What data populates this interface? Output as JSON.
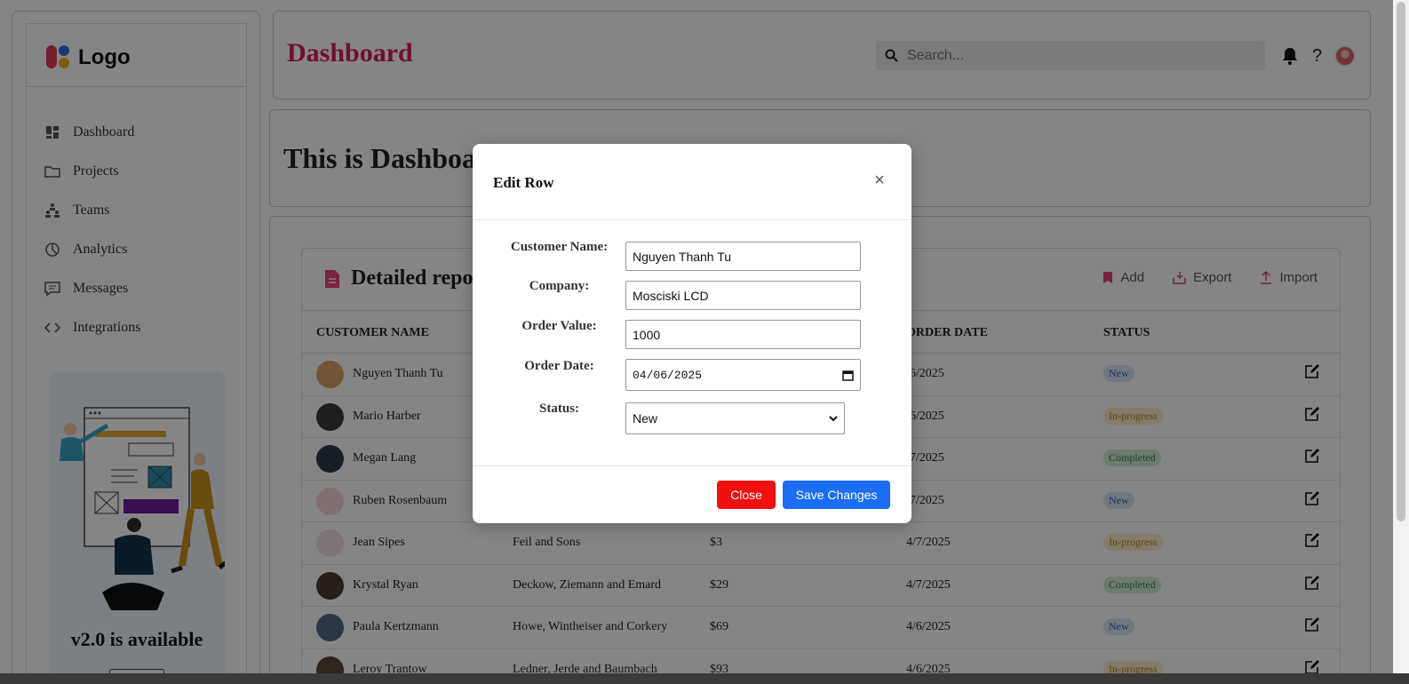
{
  "brand": {
    "logo_text": "Logo"
  },
  "sidebar": {
    "items": [
      {
        "label": "Dashboard",
        "icon": "dashboard-icon"
      },
      {
        "label": "Projects",
        "icon": "folder-icon"
      },
      {
        "label": "Teams",
        "icon": "teams-icon"
      },
      {
        "label": "Analytics",
        "icon": "pie-chart-icon"
      },
      {
        "label": "Messages",
        "icon": "message-icon"
      },
      {
        "label": "Integrations",
        "icon": "code-icon"
      }
    ],
    "promo_title": "v2.0 is available"
  },
  "header": {
    "title": "Dashboard",
    "search_placeholder": "Search...",
    "help_label": "?"
  },
  "banner": {
    "text": "This is Dashboa"
  },
  "report": {
    "title": "Detailed repo",
    "actions": {
      "add": "Add",
      "export": "Export",
      "import": "Import"
    },
    "columns": {
      "customer": "CUSTOMER NAME",
      "order_date": "ORDER DATE",
      "status": "STATUS"
    },
    "rows": [
      {
        "name": "Nguyen Thanh Tu",
        "company": "",
        "value": "",
        "date": "/6/2025",
        "status": "New",
        "kind": "new",
        "avatar": "#d9a36a"
      },
      {
        "name": "Mario Harber",
        "company": "",
        "value": "",
        "date": "/6/2025",
        "status": "In-progress",
        "kind": "progress",
        "avatar": "#3b3b3b"
      },
      {
        "name": "Megan Lang",
        "company": "",
        "value": "",
        "date": "/7/2025",
        "status": "Completed",
        "kind": "done",
        "avatar": "#2f3a4a"
      },
      {
        "name": "Ruben Rosenbaum",
        "company": "",
        "value": "",
        "date": "/7/2025",
        "status": "New",
        "kind": "new",
        "avatar": "#f5d6da"
      },
      {
        "name": "Jean Sipes",
        "company": "Feil and Sons",
        "value": "$3",
        "date": "4/7/2025",
        "status": "In-progress",
        "kind": "progress",
        "avatar": "#f3dfe3"
      },
      {
        "name": "Krystal Ryan",
        "company": "Deckow, Ziemann and Emard",
        "value": "$29",
        "date": "4/7/2025",
        "status": "Completed",
        "kind": "done",
        "avatar": "#4a3b30"
      },
      {
        "name": "Paula Kertzmann",
        "company": "Howe, Wintheiser and Corkery",
        "value": "$69",
        "date": "4/6/2025",
        "status": "New",
        "kind": "new",
        "avatar": "#546a80"
      },
      {
        "name": "Leroy Trantow",
        "company": "Ledner, Jerde and Baumbach",
        "value": "$93",
        "date": "4/6/2025",
        "status": "In-progress",
        "kind": "progress",
        "avatar": "#5a4a3a"
      }
    ]
  },
  "modal": {
    "title": "Edit Row",
    "close_glyph": "×",
    "fields": {
      "customer_label": "Customer Name:",
      "customer_value": "Nguyen Thanh Tu",
      "company_label": "Company:",
      "company_value": "Mosciski LCD",
      "order_value_label": "Order Value:",
      "order_value": "1000",
      "order_date_label": "Order Date:",
      "order_date": "04/06/2025",
      "status_label": "Status:",
      "status_value": "New"
    },
    "buttons": {
      "close": "Close",
      "save": "Save Changes"
    }
  },
  "colors": {
    "brand_pink": "#d81b60",
    "close_button": "#f10f0f",
    "save_button": "#1a6ef5"
  }
}
